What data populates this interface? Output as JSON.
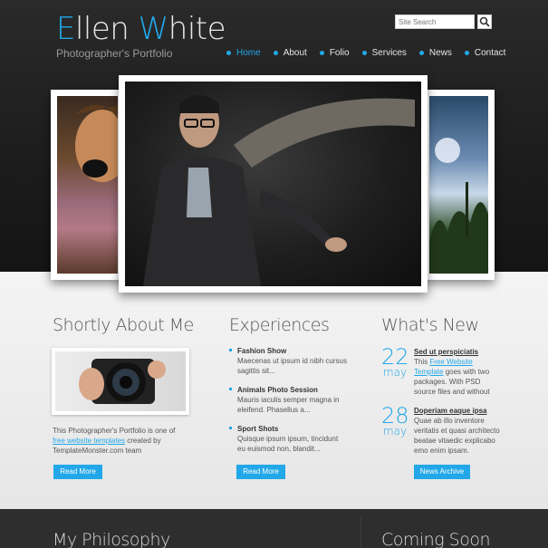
{
  "header": {
    "logo_first_cap": "E",
    "logo_first_rest": "llen ",
    "logo_last_cap": "W",
    "logo_last_rest": "hite",
    "tagline": "Photographer's Portfolio",
    "search_placeholder": "Site Search"
  },
  "nav": [
    {
      "label": "Home",
      "active": true
    },
    {
      "label": "About"
    },
    {
      "label": "Folio"
    },
    {
      "label": "Services"
    },
    {
      "label": "News"
    },
    {
      "label": "Contact"
    }
  ],
  "about": {
    "title": "Shortly About Me",
    "text_before": "This Photographer's Portfolio is one of ",
    "link": "free website templates",
    "text_after": " created by TemplateMonster.com team",
    "button": "Read More"
  },
  "experiences": {
    "title": "Experiences",
    "items": [
      {
        "title": "Fashion Show",
        "desc": "Maecenas ut ipsum id nibh cursus sagittis sit..."
      },
      {
        "title": "Animals Photo Session",
        "desc": "Mauris iaculis semper magna in eleifend. Phasellus a..."
      },
      {
        "title": "Sport Shots",
        "desc": "Quisque ipsum ipsum, tincidunt eu euismod non, blandit..."
      }
    ],
    "button": "Read More"
  },
  "news": {
    "title": "What's New",
    "items": [
      {
        "day": "22",
        "month": "may",
        "title": "Sed ut perspiciatis",
        "text_before": "This ",
        "link": "Free Website Template",
        "text_after": " goes with two packages. With PSD source files and without"
      },
      {
        "day": "28",
        "month": "may",
        "title": "Doperiam eaque ipsa",
        "text_before": "",
        "link": "",
        "text_after": "Quae ab illo inventore veritatis et quasi architecto beatae vitaedic explicabo emo enim ipsam."
      }
    ],
    "button": "News Archive"
  },
  "footer": {
    "philosophy_title": "My Philosophy",
    "coming_title": "Coming Soon"
  },
  "colors": {
    "accent": "#22a8e8",
    "header_bg": "#1c1c1c",
    "content_bg": "#ececec",
    "footer_bg": "#2e2e2e"
  }
}
